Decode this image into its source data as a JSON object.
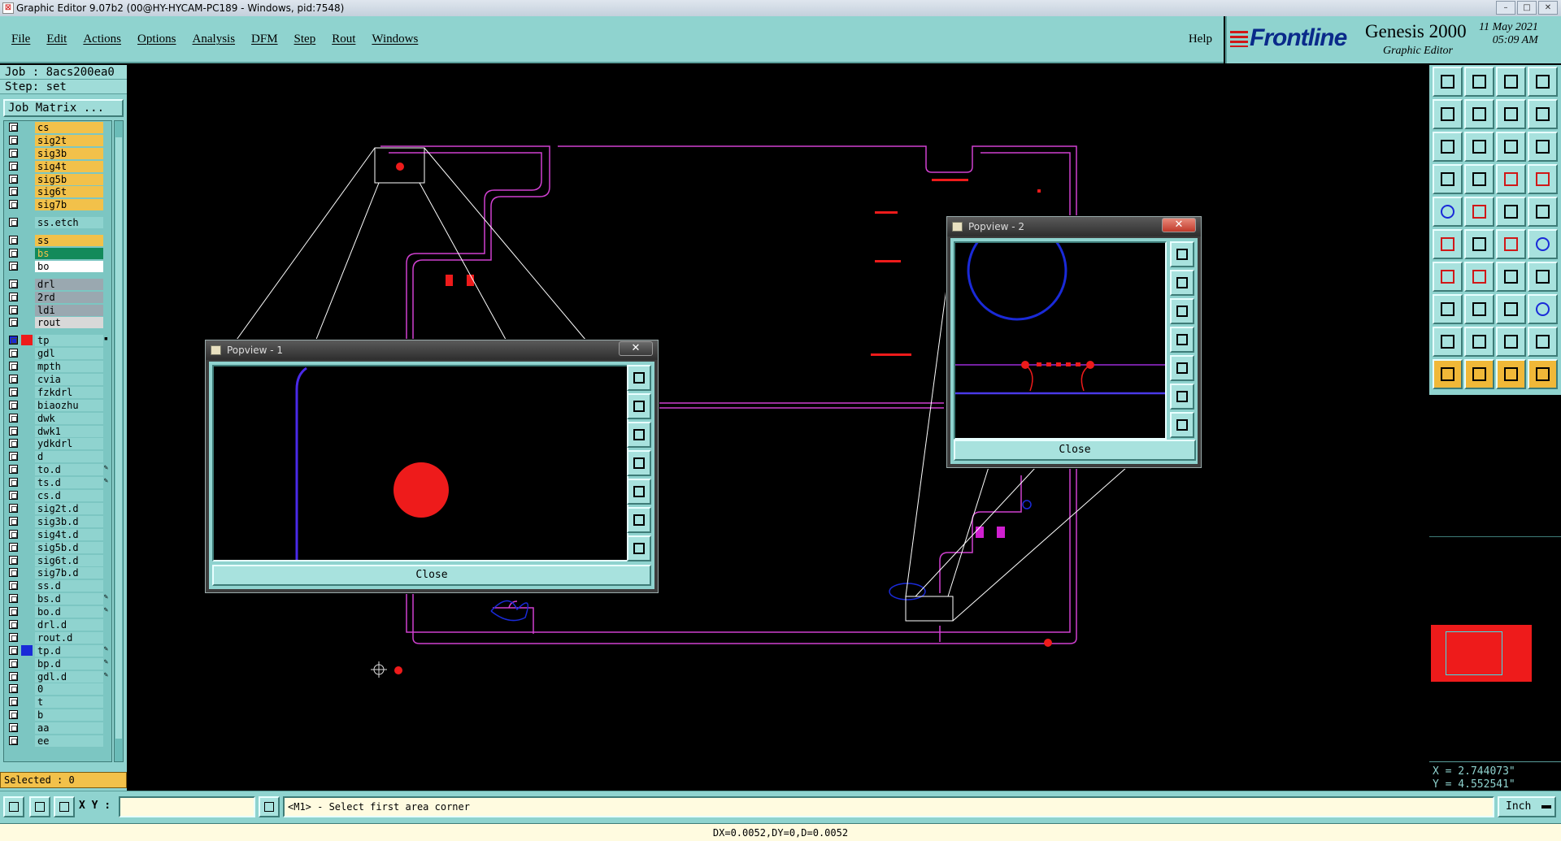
{
  "window": {
    "title": "Graphic Editor 9.07b2 (00@HY-HYCAM-PC189 - Windows, pid:7548)"
  },
  "menu": {
    "items": [
      "File",
      "Edit",
      "Actions",
      "Options",
      "Analysis",
      "DFM",
      "Step",
      "Rout",
      "Windows"
    ],
    "help": "Help"
  },
  "brand": {
    "logo": "Frontline",
    "product": "Genesis 2000",
    "subtitle": "Graphic Editor",
    "date": "11 May 2021",
    "time": "05:09 AM"
  },
  "job": {
    "job_label": "Job : 8acs200ea0",
    "step_label": "Step: set",
    "matrix_button": "Job Matrix ..."
  },
  "layers": [
    {
      "name": "cs",
      "color": "#f2c14a",
      "group": 1
    },
    {
      "name": "sig2t",
      "color": "#f2c14a",
      "group": 1
    },
    {
      "name": "sig3b",
      "color": "#f2c14a",
      "group": 1
    },
    {
      "name": "sig4t",
      "color": "#f2c14a",
      "group": 1
    },
    {
      "name": "sig5b",
      "color": "#f2c14a",
      "group": 1
    },
    {
      "name": "sig6t",
      "color": "#f2c14a",
      "group": 1
    },
    {
      "name": "sig7b",
      "color": "#f2c14a",
      "group": 1
    },
    {
      "name": "ss.etch",
      "color": "#8fd3cf",
      "group": 2
    },
    {
      "name": "ss",
      "color": "#f2c14a",
      "group": 3
    },
    {
      "name": "bs",
      "color": "#138a5a",
      "group": 3
    },
    {
      "name": "bo",
      "color": "#ffffff",
      "group": 3
    },
    {
      "name": "drl",
      "color": "#9aa8b0",
      "group": 4
    },
    {
      "name": "2rd",
      "color": "#9aa8b0",
      "group": 4
    },
    {
      "name": "ldi",
      "color": "#9aa8b0",
      "group": 4
    },
    {
      "name": "rout",
      "color": "#d8d8d8",
      "group": 4
    },
    {
      "name": "tp",
      "color": "#8fd3cf",
      "group": 5,
      "active": true
    },
    {
      "name": "gdl",
      "color": "#8fd3cf",
      "group": 5
    },
    {
      "name": "mpth",
      "color": "#8fd3cf",
      "group": 5
    },
    {
      "name": "cvia",
      "color": "#8fd3cf",
      "group": 5
    },
    {
      "name": "fzkdrl",
      "color": "#8fd3cf",
      "group": 5
    },
    {
      "name": "biaozhu",
      "color": "#8fd3cf",
      "group": 5
    },
    {
      "name": "dwk",
      "color": "#8fd3cf",
      "group": 5
    },
    {
      "name": "dwk1",
      "color": "#8fd3cf",
      "group": 5
    },
    {
      "name": "ydkdrl",
      "color": "#8fd3cf",
      "group": 5
    },
    {
      "name": "d",
      "color": "#8fd3cf",
      "group": 5
    },
    {
      "name": "to.d",
      "color": "#8fd3cf",
      "group": 5,
      "edit": true
    },
    {
      "name": "ts.d",
      "color": "#8fd3cf",
      "group": 5,
      "edit": true
    },
    {
      "name": "cs.d",
      "color": "#8fd3cf",
      "group": 5
    },
    {
      "name": "sig2t.d",
      "color": "#8fd3cf",
      "group": 5
    },
    {
      "name": "sig3b.d",
      "color": "#8fd3cf",
      "group": 5
    },
    {
      "name": "sig4t.d",
      "color": "#8fd3cf",
      "group": 5
    },
    {
      "name": "sig5b.d",
      "color": "#8fd3cf",
      "group": 5
    },
    {
      "name": "sig6t.d",
      "color": "#8fd3cf",
      "group": 5
    },
    {
      "name": "sig7b.d",
      "color": "#8fd3cf",
      "group": 5
    },
    {
      "name": "ss.d",
      "color": "#8fd3cf",
      "group": 5
    },
    {
      "name": "bs.d",
      "color": "#8fd3cf",
      "group": 5,
      "edit": true
    },
    {
      "name": "bo.d",
      "color": "#8fd3cf",
      "group": 5,
      "edit": true
    },
    {
      "name": "drl.d",
      "color": "#8fd3cf",
      "group": 5
    },
    {
      "name": "rout.d",
      "color": "#8fd3cf",
      "group": 5
    },
    {
      "name": "tp.d",
      "color": "#8fd3cf",
      "group": 5,
      "edit": true,
      "blue": true
    },
    {
      "name": "bp.d",
      "color": "#8fd3cf",
      "group": 5,
      "edit": true
    },
    {
      "name": "gdl.d",
      "color": "#8fd3cf",
      "group": 5,
      "edit": true
    },
    {
      "name": "0",
      "color": "#8fd3cf",
      "group": 5
    },
    {
      "name": "t",
      "color": "#8fd3cf",
      "group": 5
    },
    {
      "name": "b",
      "color": "#8fd3cf",
      "group": 5
    },
    {
      "name": "aa",
      "color": "#8fd3cf",
      "group": 5
    },
    {
      "name": "ee",
      "color": "#8fd3cf",
      "group": 5
    }
  ],
  "selected_label": "Selected : 0",
  "popview1": {
    "title": "Popview - 1",
    "close_label": "Close",
    "x_button": "✕"
  },
  "popview2": {
    "title": "Popview - 2",
    "close_label": "Close",
    "x_button": "✕"
  },
  "coords": {
    "x": "X = 2.744073\"",
    "y": "Y = 4.552541\""
  },
  "status": {
    "xy_label": "X Y :",
    "xy_value": "",
    "prompt": "<M1> - Select first area corner",
    "units": "Inch",
    "delta": "DX=0.0052,DY=0,D=0.0052"
  },
  "tools": [
    "window-fit-icon",
    "window-import-icon",
    "home-icon",
    "layout-icon",
    "pan-left-icon",
    "pan-right-icon",
    "mirror-icon",
    "snake-icon",
    "zoom-fit-icon",
    "center-icon",
    "scale-1-2-icon",
    "help-icon",
    "probe-icon",
    "measure-icon",
    "layer-stack-icon",
    "layer-edit-icon",
    "pad-add-icon",
    "feature-select-icon",
    "ruler-icon",
    "target-icon",
    "net-icon",
    "cross-icon",
    "connect-icon",
    "link-icon",
    "line-icon",
    "slash-icon",
    "rotate-icon",
    "snap-icon",
    "copy-icon",
    "delete-icon",
    "resize-icon",
    "share-icon",
    "triangle-icon",
    "arc-icon",
    "text-icon",
    "letter-a-icon",
    "pointer-icon",
    "select-icon",
    "pointer-add-icon",
    "pointer-connect-icon"
  ],
  "colors": {
    "panel": "#8fd3cf",
    "board_outline": "#d040d0",
    "pad": "#ee1b1b",
    "trace": "#1a2ad8"
  }
}
